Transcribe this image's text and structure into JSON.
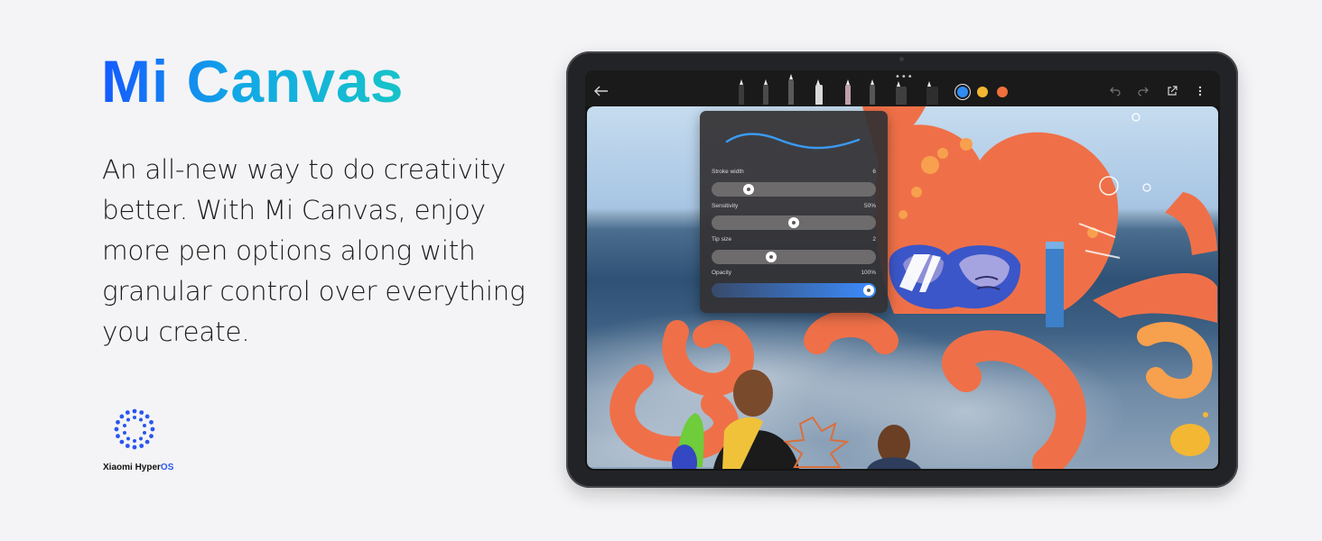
{
  "hero": {
    "title": "Mi Canvas",
    "description": "An all-new way to do creativity better. With Mi Canvas, enjoy more pen options along with granular control over everything you create."
  },
  "brand": {
    "text_main": "Xiaomi Hyper",
    "text_accent": "OS",
    "accent_color": "#2a56f0"
  },
  "app": {
    "toolbar": {
      "back_icon": "arrow-left-icon",
      "more_dots": "•••",
      "pens": [
        "pencil",
        "fountain-pen",
        "brush",
        "marker",
        "crayon",
        "fine-pen",
        "calligraphy",
        "eraser",
        "lasso"
      ],
      "colors": [
        "#2f8cf2",
        "#f2b632",
        "#f0703c"
      ],
      "selected_color": "#2f8cf2",
      "right_icons": [
        "undo-icon",
        "redo-icon",
        "share-icon",
        "more-vert-icon"
      ]
    },
    "stroke_panel": {
      "sliders": [
        {
          "label": "Stroke width",
          "value": "6",
          "level": 0.2
        },
        {
          "label": "Sensitivity",
          "value": "50%",
          "level": 0.5
        },
        {
          "label": "Tip size",
          "value": "2",
          "level": 0.35
        },
        {
          "label": "Opacity",
          "value": "100%",
          "level": 1.0
        }
      ]
    }
  }
}
